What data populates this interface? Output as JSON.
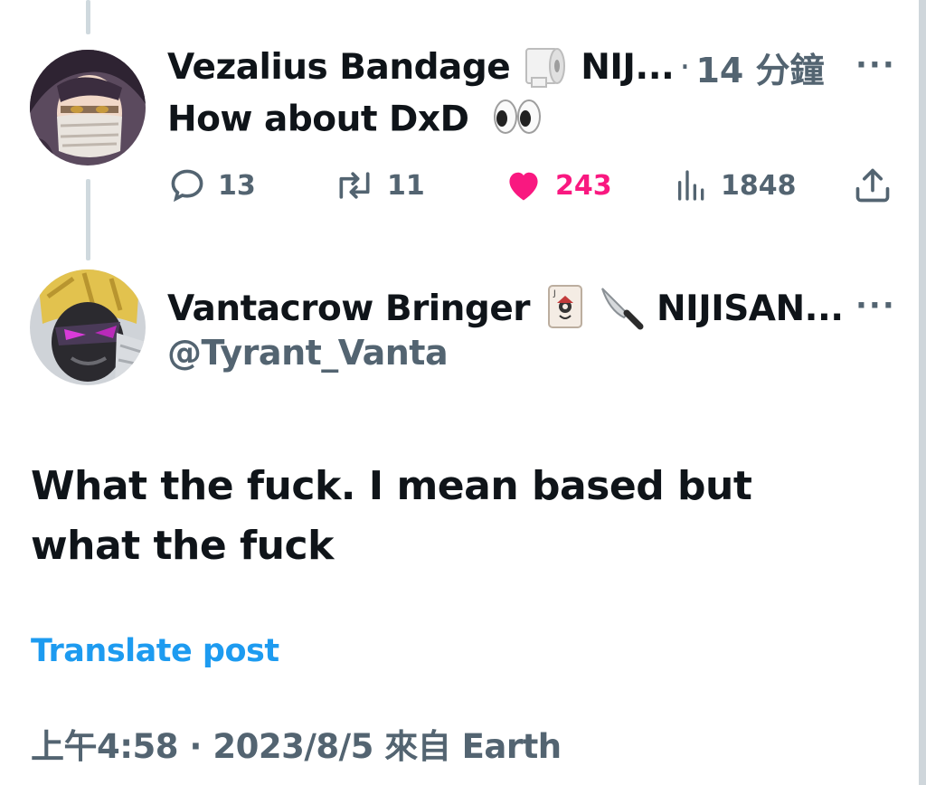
{
  "reply_post": {
    "display_name": "Vezalius Bandage",
    "name_suffix": "NIJ...",
    "separator": "·",
    "time": "14 分鐘",
    "text": "How about DxD",
    "actions": {
      "replies": "13",
      "reposts": "11",
      "likes": "243",
      "views": "1848"
    },
    "colors": {
      "like": "#f91880",
      "muted": "#536471"
    }
  },
  "main_post": {
    "display_name": "Vantacrow Bringer",
    "name_suffix": "NIJISAN...",
    "handle": "@Tyrant_Vanta",
    "text": "What the fuck. I mean based but what the fuck",
    "translate_label": "Translate post",
    "meta": "上午4:58 · 2023/8/5 來自 Earth"
  },
  "icons": {
    "reply": "speech-bubble-icon",
    "repost": "repost-arrows-icon",
    "like": "heart-icon",
    "views": "bar-chart-icon",
    "share": "share-upload-icon",
    "more": "more-dots-icon"
  },
  "colors": {
    "link": "#1d9bf0",
    "text": "#0f1419",
    "thread_line": "#cfd9de"
  }
}
